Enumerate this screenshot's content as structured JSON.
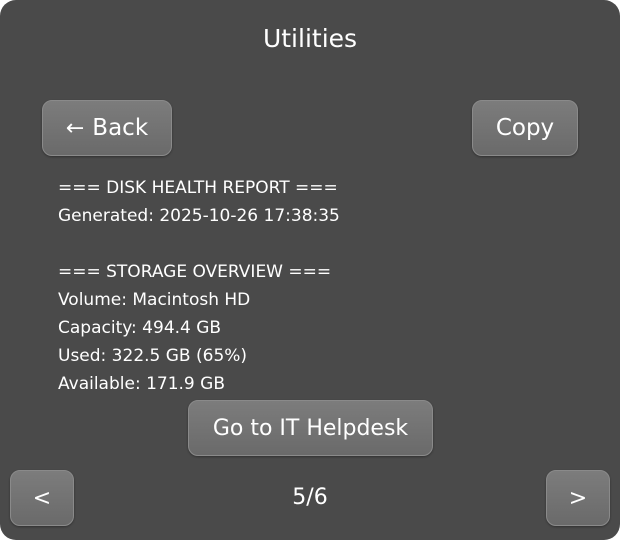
{
  "window": {
    "title": "Utilities"
  },
  "toolbar": {
    "back_label": "Back",
    "back_icon": "left-arrow-icon",
    "copy_label": "Copy"
  },
  "report": {
    "lines": [
      "=== DISK HEALTH REPORT ===",
      "Generated: 2025-10-26 17:38:35",
      "",
      "=== STORAGE OVERVIEW ===",
      "Volume: Macintosh HD",
      "Capacity: 494.4 GB",
      "Used: 322.5 GB (65%)",
      "Available: 171.9 GB"
    ]
  },
  "actions": {
    "helpdesk_label": "Go to IT Helpdesk"
  },
  "pagination": {
    "prev_label": "<",
    "next_label": ">",
    "current": "5/6"
  },
  "colors": {
    "panel_background": "#4a4a4a",
    "button_background": "#747474",
    "text": "#ffffff"
  }
}
